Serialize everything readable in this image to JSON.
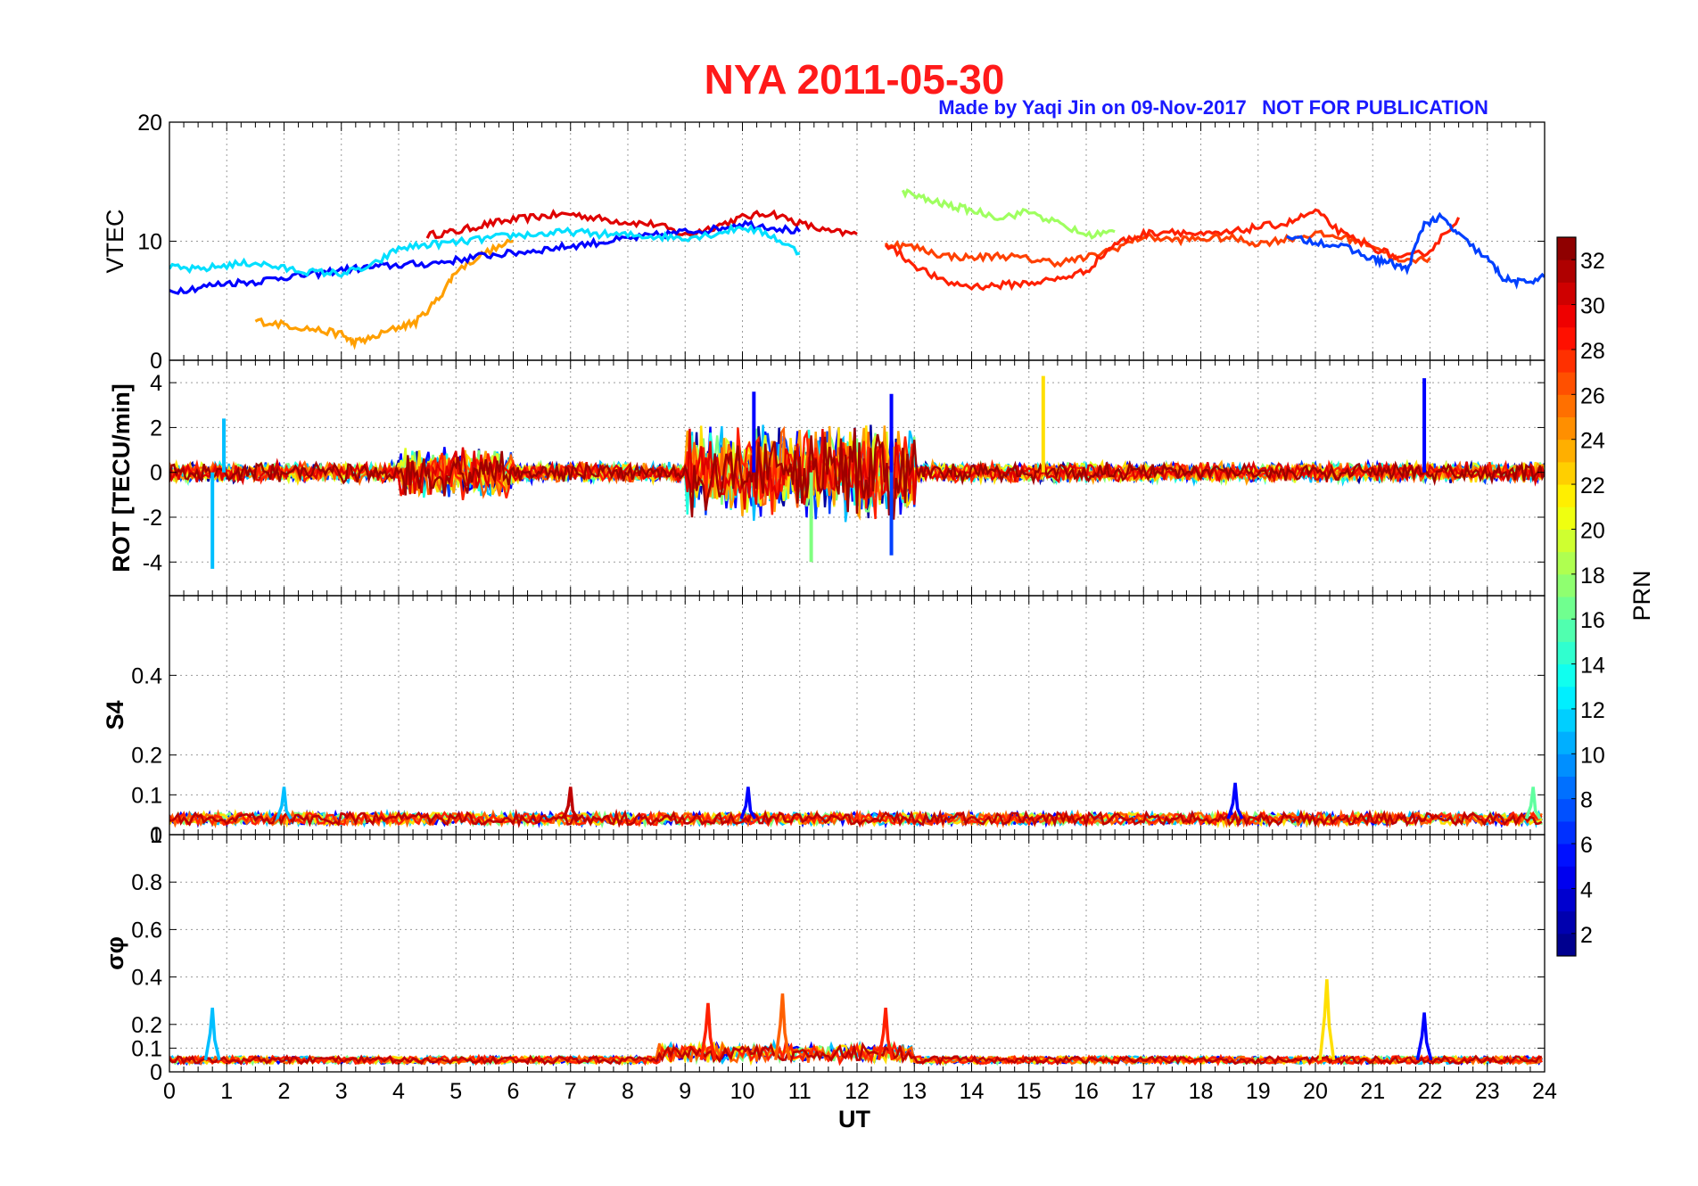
{
  "figure": {
    "title": "NYA   2011-05-30",
    "credit": "Made by Yaqi Jin on 09-Nov-2017",
    "notice": "NOT FOR PUBLICATION",
    "title_color": "#ff1a1a",
    "credit_color": "#1a1aff"
  },
  "colorbar": {
    "label": "PRN",
    "ticks": [
      "2",
      "4",
      "6",
      "8",
      "10",
      "12",
      "14",
      "16",
      "18",
      "20",
      "22",
      "24",
      "26",
      "28",
      "30",
      "32"
    ],
    "range": [
      1,
      33
    ],
    "colormap": "jet"
  },
  "chart_data": [
    {
      "type": "line",
      "panel": "vtec",
      "ylabel": "VTEC",
      "ylim": [
        0,
        20
      ],
      "yticks": [
        "0",
        "10",
        "20"
      ],
      "xlim": [
        0,
        24
      ],
      "grid": true,
      "series_summary": [
        {
          "prn": 30,
          "x": [
            4.5,
            5,
            5.5,
            6,
            6.5,
            7,
            7.5,
            8,
            8.5,
            9,
            9.5,
            10,
            10.5,
            11,
            11.5,
            12
          ],
          "values": [
            10.5,
            10.8,
            11.4,
            11.8,
            12.1,
            12.3,
            11.9,
            11.6,
            11.4,
            10.5,
            11.2,
            12,
            12.4,
            11.5,
            10.8,
            10.6
          ]
        },
        {
          "prn": 24,
          "x": [
            1.5,
            2,
            2.5,
            3,
            3.2,
            3.5,
            4,
            4.3,
            4.7,
            5,
            5.5,
            6
          ],
          "values": [
            3.3,
            3,
            2.6,
            2.2,
            1.5,
            1.8,
            2.8,
            3.2,
            5.2,
            7.5,
            9,
            10
          ]
        },
        {
          "prn": 5,
          "x": [
            0,
            0.5,
            1,
            1.5,
            2,
            2.5,
            3,
            3.5,
            4,
            4.5,
            5,
            5.5,
            6,
            6.5,
            7,
            7.5,
            8,
            8.5,
            9,
            9.5,
            10,
            10.5,
            11
          ],
          "values": [
            5.8,
            6.1,
            6.5,
            6.6,
            7,
            7.2,
            7.6,
            7.8,
            8,
            8.1,
            8.4,
            8.8,
            9,
            9.3,
            9.6,
            9.9,
            10.2,
            10.5,
            10.8,
            11,
            11.5,
            11.2,
            10.8
          ]
        },
        {
          "prn": 12,
          "x": [
            0,
            0.5,
            1,
            1.5,
            2,
            2.5,
            3,
            3.5,
            4,
            4.5,
            5,
            5.5,
            6,
            6.5,
            7,
            7.5,
            8,
            8.5,
            9,
            9.5,
            10,
            10.5,
            11
          ],
          "values": [
            7.8,
            7.6,
            8,
            8.2,
            7.7,
            7.4,
            7.3,
            7.8,
            9.4,
            9.7,
            9.9,
            10.2,
            10.5,
            10.6,
            10.8,
            10.6,
            10.5,
            10.4,
            10.3,
            10.6,
            11.2,
            10.5,
            9
          ]
        },
        {
          "prn": 27,
          "x": [
            12.5,
            13,
            13.5,
            14,
            14.5,
            15,
            15.5,
            16,
            16.5,
            17,
            17.5,
            18,
            18.5,
            19,
            19.5,
            20,
            20.5,
            21,
            21.5,
            22
          ],
          "values": [
            9.8,
            9.5,
            8.8,
            8.6,
            8.8,
            8.5,
            8.2,
            8.6,
            9.4,
            10.4,
            10.1,
            10.2,
            10.3,
            9.8,
            10.2,
            10.6,
            10.3,
            9.7,
            8.2,
            8.6
          ]
        },
        {
          "prn": 28,
          "x": [
            12.5,
            13,
            13.5,
            14,
            14.5,
            15,
            15.5,
            16,
            16.5,
            17,
            17.5,
            18,
            18.5,
            19,
            19.5,
            20,
            20.5,
            21,
            21.5,
            22,
            22.5
          ],
          "values": [
            9.8,
            8,
            6.6,
            6.2,
            6.3,
            6.5,
            6.8,
            7.5,
            9.8,
            10.6,
            10.9,
            10.5,
            10.7,
            11.2,
            11.5,
            12.5,
            10.5,
            9.5,
            8.5,
            9.2,
            12
          ]
        },
        {
          "prn": 7,
          "x": [
            19.5,
            20,
            20.5,
            21,
            21.3,
            21.6,
            21.9,
            22.2,
            22.5,
            23,
            23.3,
            23.6,
            24
          ],
          "values": [
            10.2,
            10,
            9.5,
            8.5,
            8.2,
            7.6,
            11.5,
            12,
            10.5,
            8.5,
            6.8,
            6.5,
            7
          ]
        },
        {
          "prn": 18,
          "x": [
            12.8,
            13.2,
            13.6,
            14,
            14.5,
            15,
            15.5,
            16,
            16.5
          ],
          "values": [
            14.2,
            13.5,
            13,
            12.6,
            12,
            12.5,
            11.5,
            10.5,
            10.8
          ]
        }
      ]
    },
    {
      "type": "line",
      "panel": "rot",
      "ylabel": "ROT [TECU/min]",
      "ylim": [
        -5.5,
        5
      ],
      "yticks": [
        "-4",
        "-2",
        "0",
        "2",
        "4"
      ],
      "xlim": [
        0,
        24
      ],
      "grid": true,
      "noted_spikes": [
        {
          "prn": 11,
          "x": 0.75,
          "value": -4.3
        },
        {
          "prn": 11,
          "x": 0.95,
          "value": 2.4
        },
        {
          "prn": 5,
          "x": 10.2,
          "value": 3.6
        },
        {
          "prn": 5,
          "x": 12.6,
          "value": 3.5
        },
        {
          "prn": 17,
          "x": 11.2,
          "value": -4
        },
        {
          "prn": 22,
          "x": 15.25,
          "value": 4.3
        },
        {
          "prn": 5,
          "x": 21.9,
          "value": 4.2
        },
        {
          "prn": 7,
          "x": 12.6,
          "value": -3.7
        }
      ]
    },
    {
      "type": "line",
      "panel": "s4",
      "ylabel": "S4",
      "ylim": [
        0,
        0.6
      ],
      "yticks": [
        "0",
        "0.1",
        "0.2",
        "0.4"
      ],
      "xlim": [
        0,
        24
      ],
      "grid": true,
      "baseline": 0.04,
      "noted_peaks": [
        {
          "prn": 31,
          "x": 7,
          "value": 0.12
        },
        {
          "prn": 11,
          "x": 2,
          "value": 0.12
        },
        {
          "prn": 5,
          "x": 10.1,
          "value": 0.12
        },
        {
          "prn": 5,
          "x": 18.6,
          "value": 0.13
        },
        {
          "prn": 16,
          "x": 23.8,
          "value": 0.12
        }
      ]
    },
    {
      "type": "line",
      "panel": "sigma_phi",
      "ylabel": "σφ",
      "ylim": [
        0,
        1
      ],
      "yticks": [
        "0",
        "0.1",
        "0.2",
        "0.4",
        "0.6",
        "0.8",
        "1"
      ],
      "xlim": [
        0,
        24
      ],
      "grid": true,
      "baseline": 0.05,
      "noted_peaks": [
        {
          "prn": 11,
          "x": 0.75,
          "value": 0.27
        },
        {
          "prn": 28,
          "x": 9.4,
          "value": 0.29
        },
        {
          "prn": 26,
          "x": 10.7,
          "value": 0.33
        },
        {
          "prn": 28,
          "x": 12.5,
          "value": 0.27
        },
        {
          "prn": 22,
          "x": 20.2,
          "value": 0.39
        },
        {
          "prn": 5,
          "x": 21.9,
          "value": 0.25
        }
      ]
    }
  ],
  "xaxis": {
    "label": "UT",
    "ticks": [
      "0",
      "1",
      "2",
      "3",
      "4",
      "5",
      "6",
      "7",
      "8",
      "9",
      "10",
      "11",
      "12",
      "13",
      "14",
      "15",
      "16",
      "17",
      "18",
      "19",
      "20",
      "21",
      "22",
      "23",
      "24"
    ]
  }
}
